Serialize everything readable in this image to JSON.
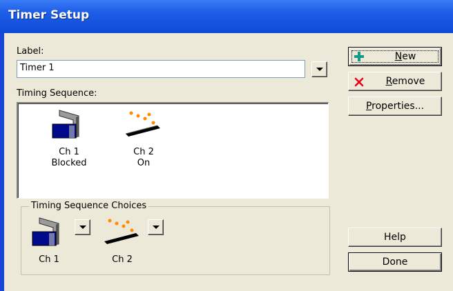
{
  "window": {
    "title": "Timer Setup"
  },
  "label_field": {
    "caption": "Label:",
    "value": "Timer 1"
  },
  "timing_sequence": {
    "caption": "Timing Sequence:",
    "items": [
      {
        "channel": "Ch 1",
        "state": "Blocked",
        "icon": "blocked-sensor-icon"
      },
      {
        "channel": "Ch 2",
        "state": "On",
        "icon": "light-on-icon"
      }
    ]
  },
  "choices": {
    "caption": "Timing Sequence Choices",
    "items": [
      {
        "channel": "Ch 1",
        "icon": "blocked-sensor-icon"
      },
      {
        "channel": "Ch 2",
        "icon": "light-on-icon"
      }
    ]
  },
  "buttons": {
    "new": {
      "accel": "N",
      "rest": "ew"
    },
    "remove": {
      "accel": "R",
      "rest": "emove"
    },
    "properties": {
      "accel": "P",
      "rest": "roperties..."
    },
    "help": "Help",
    "done": "Done"
  },
  "colors": {
    "titlebar": "#0f4ad6",
    "face": "#ece9d8",
    "new_plus": "#119a8a",
    "remove_x": "#e8001a",
    "sensor_blue": "#000a8a",
    "light_dot": "#ff8a00"
  }
}
